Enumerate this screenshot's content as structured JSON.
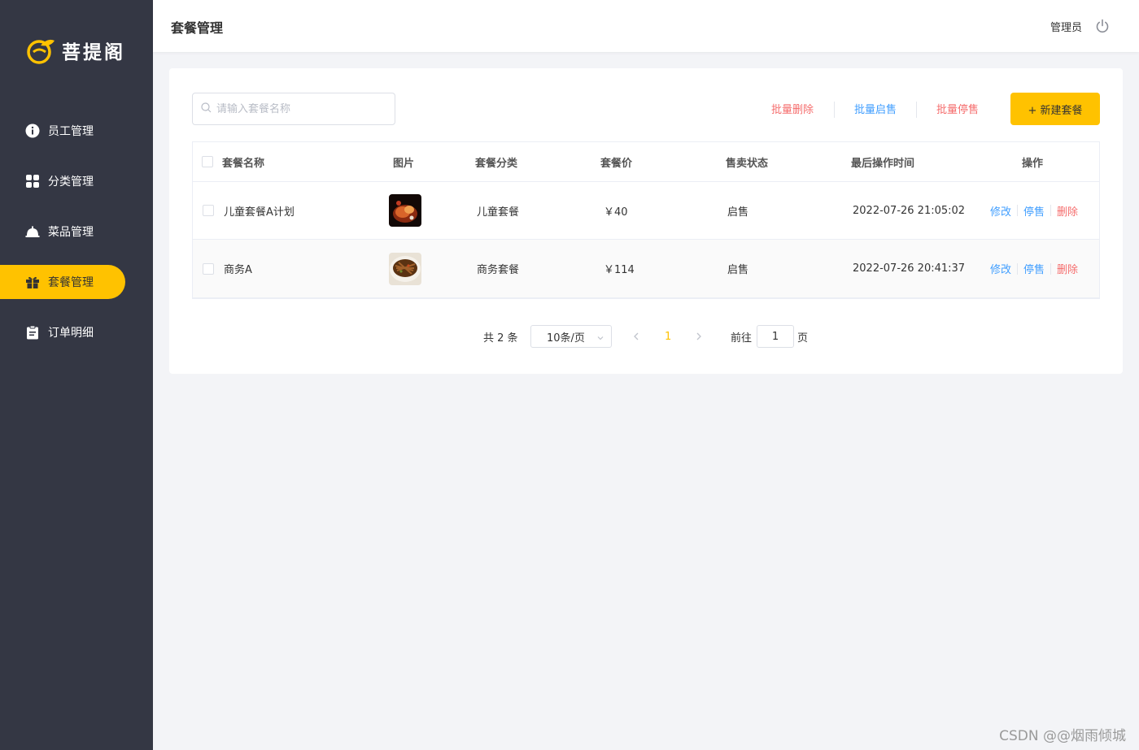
{
  "brand": {
    "name": "菩提阁"
  },
  "sidebar": {
    "items": [
      {
        "label": "员工管理",
        "icon": "info-icon",
        "active": false
      },
      {
        "label": "分类管理",
        "icon": "grid-icon",
        "active": false
      },
      {
        "label": "菜品管理",
        "icon": "cloche-icon",
        "active": false
      },
      {
        "label": "套餐管理",
        "icon": "gift-icon",
        "active": true
      },
      {
        "label": "订单明细",
        "icon": "clipboard-icon",
        "active": false
      }
    ]
  },
  "header": {
    "title": "套餐管理",
    "user": "管理员",
    "power_icon": "power-icon"
  },
  "toolbar": {
    "search_placeholder": "请输入套餐名称",
    "batch_delete": "批量删除",
    "batch_enable": "批量启售",
    "batch_disable": "批量停售",
    "new_button": "+ 新建套餐"
  },
  "table": {
    "columns": [
      "套餐名称",
      "图片",
      "套餐分类",
      "套餐价",
      "售卖状态",
      "最后操作时间",
      "操作"
    ],
    "rows": [
      {
        "name": "儿童套餐A计划",
        "category": "儿童套餐",
        "price": "￥40",
        "status": "启售",
        "updated": "2022-07-26 21:05:02",
        "ops": [
          "修改",
          "停售",
          "删除"
        ]
      },
      {
        "name": "商务A",
        "category": "商务套餐",
        "price": "￥114",
        "status": "启售",
        "updated": "2022-07-26 20:41:37",
        "ops": [
          "修改",
          "停售",
          "删除"
        ]
      }
    ]
  },
  "pagination": {
    "total": "共 2 条",
    "page_size": "10条/页",
    "current_page": "1",
    "goto_label": "前往",
    "goto_value": "1",
    "page_suffix": "页"
  },
  "watermark": "CSDN @@烟雨倾城",
  "colors": {
    "accent": "#ffc200",
    "sidebar_bg": "#343744",
    "link_blue": "#409eff",
    "danger_red": "#f56c6c"
  }
}
